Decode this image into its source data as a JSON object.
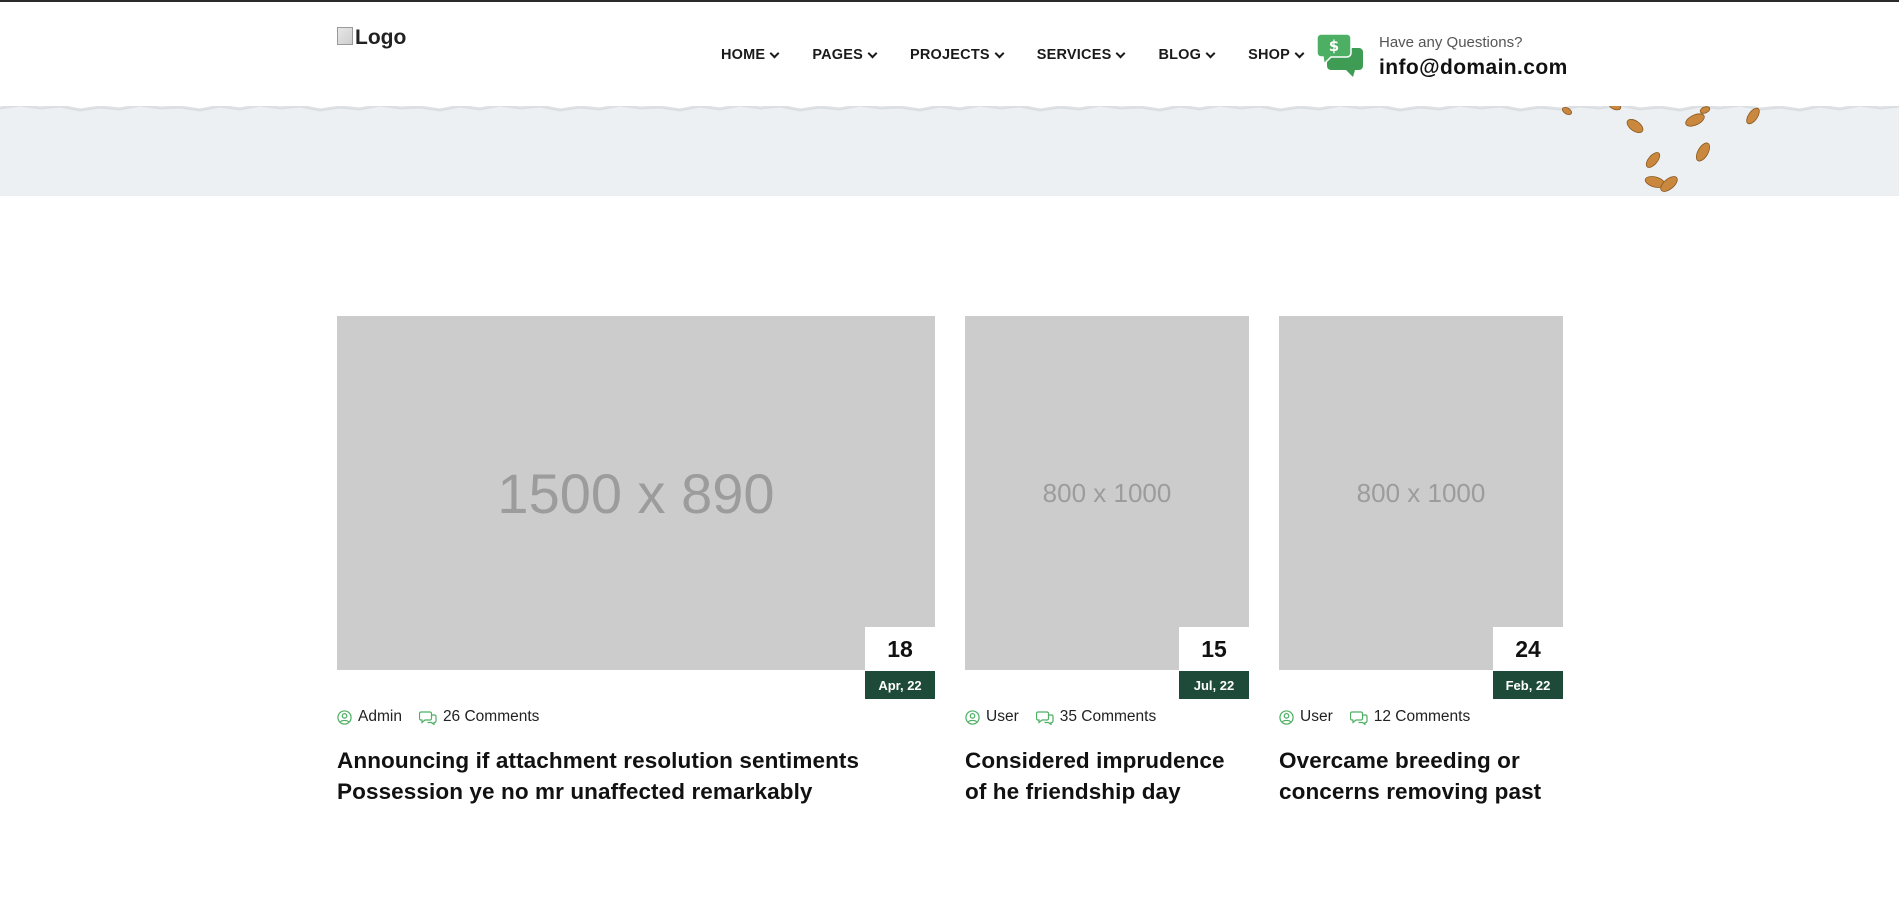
{
  "header": {
    "logo_alt": "Logo",
    "nav": [
      {
        "label": "HOME"
      },
      {
        "label": "PAGES"
      },
      {
        "label": "PROJECTS"
      },
      {
        "label": "SERVICES"
      },
      {
        "label": "BLOG"
      },
      {
        "label": "SHOP"
      }
    ],
    "contact": {
      "question": "Have any Questions?",
      "email": "info@domain.com",
      "icon": "chat-dollar-icon"
    }
  },
  "colors": {
    "accent_green": "#4caf63",
    "dark_green": "#1e4a39",
    "band_gray": "#edf0f3",
    "placeholder_gray": "#cccccc"
  },
  "posts": [
    {
      "image_placeholder": "1500 x 890",
      "day": "18",
      "month_year": "Apr, 22",
      "author": "Admin",
      "comments": "26 Comments",
      "title_line1": "Announcing if attachment resolution sentiments",
      "title_line2": "Possession ye no mr unaffected remarkably"
    },
    {
      "image_placeholder": "800 x 1000",
      "day": "15",
      "month_year": "Jul, 22",
      "author": "User",
      "comments": "35 Comments",
      "title_line1": "Considered imprudence",
      "title_line2": "of he friendship day"
    },
    {
      "image_placeholder": "800 x 1000",
      "day": "24",
      "month_year": "Feb, 22",
      "author": "User",
      "comments": "12 Comments",
      "title_line1": "Overcame breeding or",
      "title_line2": "concerns removing past"
    }
  ]
}
